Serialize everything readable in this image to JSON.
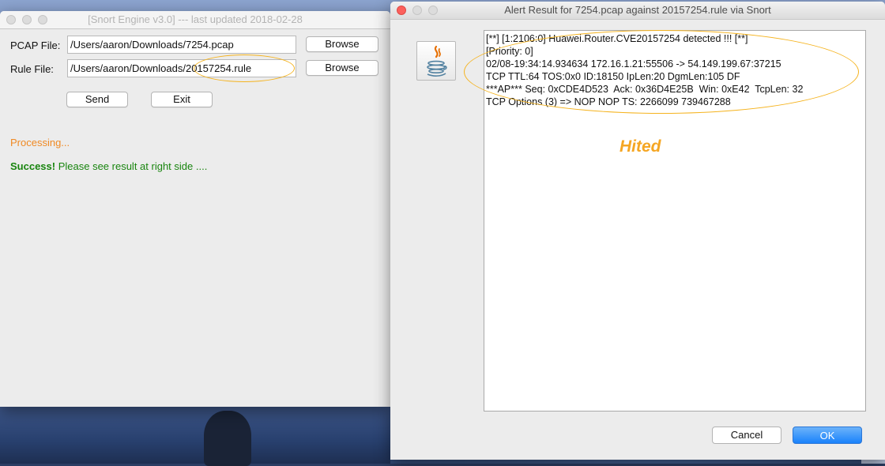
{
  "engine_window": {
    "title": "[Snort Engine v3.0]  --- last updated 2018-02-28",
    "pcap_label": "PCAP File:",
    "pcap_value": "/Users/aaron/Downloads/7254.pcap",
    "rule_label": "Rule File:",
    "rule_value": "/Users/aaron/Downloads/20157254.rule",
    "browse_label": "Browse",
    "send_label": "Send",
    "exit_label": "Exit",
    "processing_text": "Processing...",
    "success_bold": "Success!",
    "success_text": " Please see result at right side ...."
  },
  "alert_window": {
    "title": "Alert Result for 7254.pcap against 20157254.rule via Snort",
    "lines": [
      "[**] [1:2106:0] Huawei.Router.CVE20157254 detected !!! [**]",
      "[Priority: 0]",
      "02/08-19:34:14.934634 172.16.1.21:55506 -> 54.149.199.67:37215",
      "TCP TTL:64 TOS:0x0 ID:18150 IpLen:20 DgmLen:105 DF",
      "***AP*** Seq: 0xCDE4D523  Ack: 0x36D4E25B  Win: 0xE42  TcpLen: 32",
      "TCP Options (3) => NOP NOP TS: 2266099 739467288"
    ],
    "annotation": "Hited",
    "cancel_label": "Cancel",
    "ok_label": "OK"
  },
  "icons": [
    "java-icon"
  ],
  "colors": {
    "processing": "#f08a24",
    "success": "#19850f",
    "annotation": "#f5a623",
    "ok_button": "#1a82fb"
  }
}
